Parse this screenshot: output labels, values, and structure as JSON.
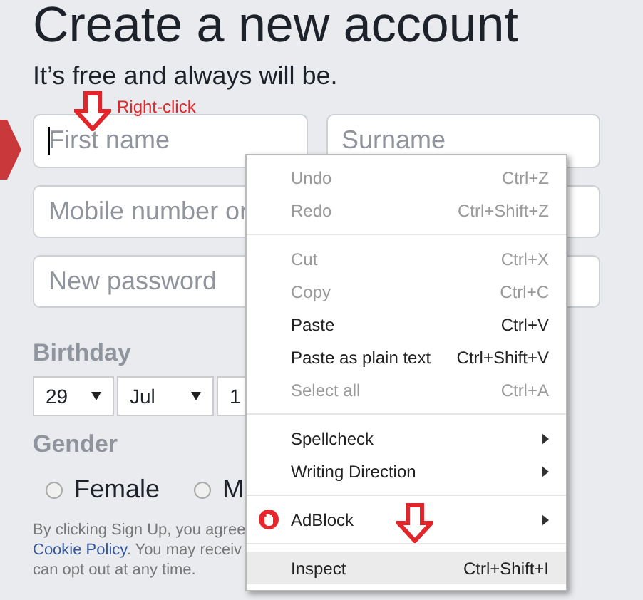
{
  "title": "Create a new account",
  "subtitle": "It’s free and always will be.",
  "annotation": {
    "label": "Right-click"
  },
  "name_fields": [
    {
      "placeholder": "First name",
      "focused": true
    },
    {
      "placeholder": "Surname",
      "focused": false
    }
  ],
  "fields": [
    {
      "placeholder": "Mobile number or"
    },
    {
      "placeholder": "New password"
    }
  ],
  "birthday": {
    "label": "Birthday",
    "selects": [
      "29",
      "Jul",
      "1"
    ]
  },
  "gender": {
    "label": "Gender",
    "options": [
      {
        "label": "Female",
        "selected": false
      },
      {
        "label": "M",
        "selected": false
      }
    ]
  },
  "consent": [
    {
      "text": "By clicking Sign Up, you agree"
    },
    {
      "link": "Cookie Policy",
      "text": ". You may receiv"
    },
    {
      "text": "can opt out at any time."
    }
  ],
  "context_menu": [
    {
      "kind": "item",
      "label": "Undo",
      "shortcut": "Ctrl+Z",
      "disabled": true,
      "submenu": false,
      "selected": false
    },
    {
      "kind": "item",
      "label": "Redo",
      "shortcut": "Ctrl+Shift+Z",
      "disabled": true,
      "submenu": false,
      "selected": false
    },
    {
      "kind": "separator"
    },
    {
      "kind": "item",
      "label": "Cut",
      "shortcut": "Ctrl+X",
      "disabled": true,
      "submenu": false,
      "selected": false
    },
    {
      "kind": "item",
      "label": "Copy",
      "shortcut": "Ctrl+C",
      "disabled": true,
      "submenu": false,
      "selected": false
    },
    {
      "kind": "item",
      "label": "Paste",
      "shortcut": "Ctrl+V",
      "disabled": false,
      "submenu": false,
      "selected": false
    },
    {
      "kind": "item",
      "label": "Paste as plain text",
      "shortcut": "Ctrl+Shift+V",
      "disabled": false,
      "submenu": false,
      "selected": false
    },
    {
      "kind": "item",
      "label": "Select all",
      "shortcut": "Ctrl+A",
      "disabled": true,
      "submenu": false,
      "selected": false
    },
    {
      "kind": "separator"
    },
    {
      "kind": "item",
      "label": "Spellcheck",
      "disabled": false,
      "submenu": true,
      "selected": false
    },
    {
      "kind": "item",
      "label": "Writing Direction",
      "disabled": false,
      "submenu": true,
      "selected": false
    },
    {
      "kind": "separator"
    },
    {
      "kind": "adblock",
      "label": "AdBlock",
      "disabled": false,
      "submenu": true,
      "selected": false
    },
    {
      "kind": "separator"
    },
    {
      "kind": "item",
      "label": "Inspect",
      "shortcut": "Ctrl+Shift+I",
      "disabled": false,
      "submenu": false,
      "selected": true
    }
  ]
}
